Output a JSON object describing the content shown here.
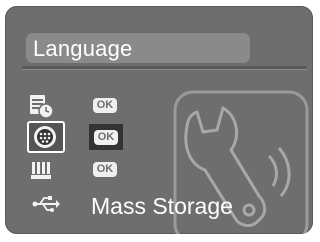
{
  "screen": {
    "title": "Language",
    "items": [
      {
        "icon": "datetime-icon",
        "value": "OK"
      },
      {
        "icon": "language-globe-icon",
        "value": "OK",
        "selected": true
      },
      {
        "icon": "tv-out-icon",
        "value": "OK"
      },
      {
        "icon": "usb-icon",
        "value": "Mass Storage"
      }
    ],
    "background_icon": "wrench-setup-icon"
  },
  "colors": {
    "background": "#6e6e6e",
    "title_bar": "#8a8a8a",
    "selection": "#333333",
    "text": "#ffffff"
  }
}
